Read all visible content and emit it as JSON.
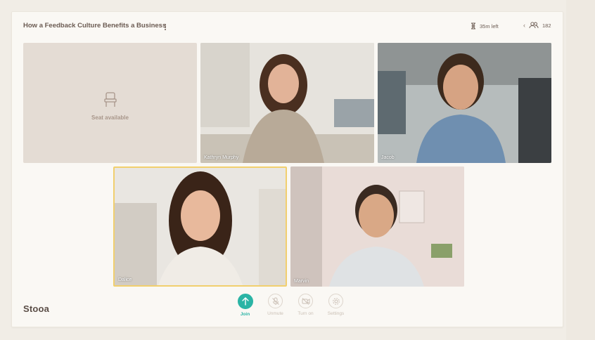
{
  "header": {
    "title": "How a Feedback Culture Benefits a Business",
    "time_left": "35m left",
    "participant_count": "182"
  },
  "seat": {
    "label": "Seat available"
  },
  "participants": [
    {
      "name": "Kathryn Murphy"
    },
    {
      "name": "Jacob"
    },
    {
      "name": "Dalice"
    },
    {
      "name": "Marvin"
    }
  ],
  "footer": {
    "logo": "Stooa"
  },
  "controls": [
    {
      "label": "Join",
      "icon": "arrow-up-icon"
    },
    {
      "label": "Unmute",
      "icon": "mic-off-icon"
    },
    {
      "label": "Turn on",
      "icon": "camera-off-icon"
    },
    {
      "label": "Settings",
      "icon": "gear-icon"
    }
  ],
  "colors": {
    "accent": "#2bb4a5",
    "speaker_border": "#f1cf6e",
    "seat_bg": "#e4dcd4"
  }
}
